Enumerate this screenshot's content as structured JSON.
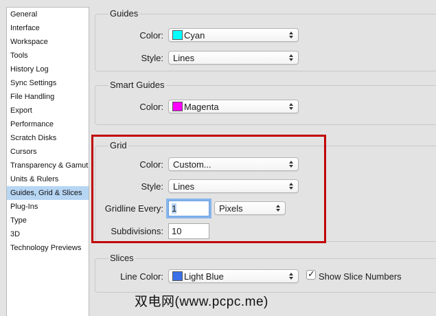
{
  "sidebar": {
    "items": [
      {
        "label": "General"
      },
      {
        "label": "Interface"
      },
      {
        "label": "Workspace"
      },
      {
        "label": "Tools"
      },
      {
        "label": "History Log"
      },
      {
        "label": "Sync Settings"
      },
      {
        "label": "File Handling"
      },
      {
        "label": "Export"
      },
      {
        "label": "Performance"
      },
      {
        "label": "Scratch Disks"
      },
      {
        "label": "Cursors"
      },
      {
        "label": "Transparency & Gamut"
      },
      {
        "label": "Units & Rulers"
      },
      {
        "label": "Guides, Grid & Slices"
      },
      {
        "label": "Plug-Ins"
      },
      {
        "label": "Type"
      },
      {
        "label": "3D"
      },
      {
        "label": "Technology Previews"
      }
    ],
    "active": "Guides, Grid & Slices"
  },
  "guides": {
    "title": "Guides",
    "color_label": "Color:",
    "color_value": "Cyan",
    "color_swatch": "#00ffff",
    "style_label": "Style:",
    "style_value": "Lines"
  },
  "smart_guides": {
    "title": "Smart Guides",
    "color_label": "Color:",
    "color_value": "Magenta",
    "color_swatch": "#ff00ff"
  },
  "grid": {
    "title": "Grid",
    "color_label": "Color:",
    "color_value": "Custom...",
    "style_label": "Style:",
    "style_value": "Lines",
    "gridline_label": "Gridline Every:",
    "gridline_value": "1",
    "gridline_unit": "Pixels",
    "subdivisions_label": "Subdivisions:",
    "subdivisions_value": "10"
  },
  "slices": {
    "title": "Slices",
    "line_color_label": "Line Color:",
    "line_color_value": "Light Blue",
    "line_color_swatch": "#3d6fe8",
    "show_numbers_label": "Show Slice Numbers",
    "show_numbers_checked": true
  },
  "watermark": "双电网(www.pcpc.me)",
  "colors": {
    "highlight": "#c00000",
    "active_sidebar": "#b7d6f4"
  }
}
